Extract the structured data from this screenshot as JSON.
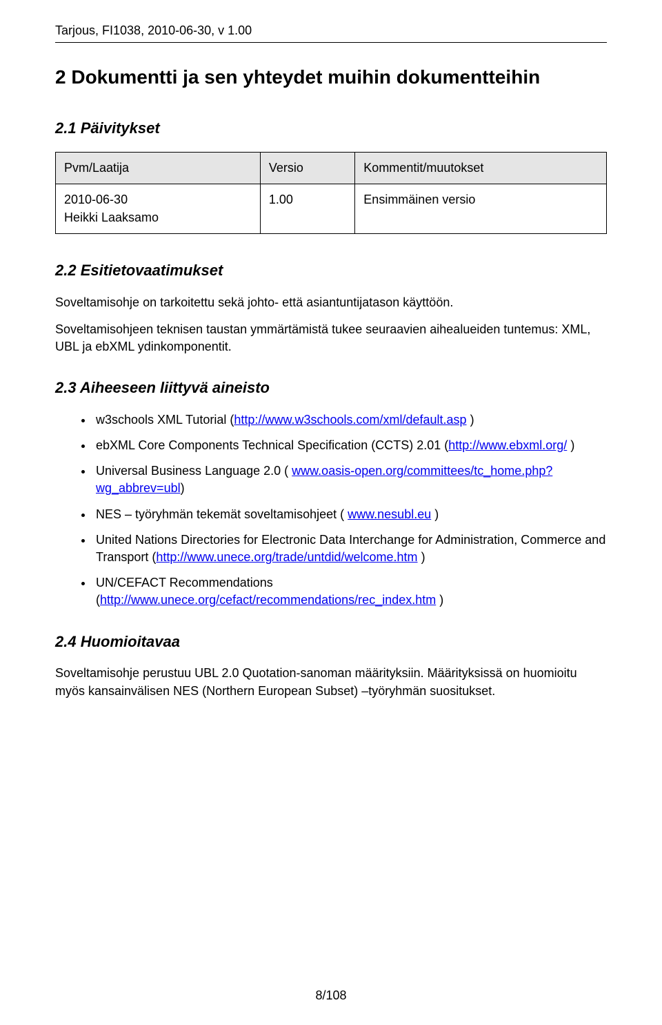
{
  "header": "Tarjous, FI1038, 2010-06-30, v 1.00",
  "chapter": "2   Dokumentti ja sen yhteydet muihin dokumentteihin",
  "sections": {
    "s21": {
      "title": "2.1   Päivitykset",
      "table": {
        "headers": [
          "Pvm/Laatija",
          "Versio",
          "Kommentit/muutokset"
        ],
        "rows": [
          {
            "pvm": "2010-06-30",
            "author": "Heikki Laaksamo",
            "versio": "1.00",
            "kommentit": "Ensimmäinen versio"
          }
        ]
      }
    },
    "s22": {
      "title": "2.2   Esitietovaatimukset",
      "para1": "Soveltamisohje on tarkoitettu sekä johto- että asiantuntijatason käyttöön.",
      "para2": "Soveltamisohjeen teknisen taustan ymmärtämistä tukee seuraavien aihealueiden tuntemus: XML, UBL ja ebXML ydinkomponentit."
    },
    "s23": {
      "title": "2.3   Aiheeseen liittyvä aineisto",
      "items": [
        {
          "pre": "w3schools XML Tutorial (",
          "link": "http://www.w3schools.com/xml/default.asp",
          "post": " )"
        },
        {
          "pre": "ebXML Core Components Technical Specification (CCTS) 2.01 (",
          "link": "http://www.ebxml.org/",
          "post": " )"
        },
        {
          "pre": "Universal Business Language 2.0 ( ",
          "link": "www.oasis-open.org/committees/tc_home.php?wg_abbrev=ubl",
          "post": ")"
        },
        {
          "pre": "NES – työryhmän tekemät soveltamisohjeet ( ",
          "link": "www.nesubl.eu",
          "post": " )"
        },
        {
          "pre": "United Nations Directories for Electronic Data Interchange for Administration, Commerce and Transport (",
          "link": "http://www.unece.org/trade/untdid/welcome.htm",
          "post": " )"
        },
        {
          "pre": "UN/CEFACT Recommendations (",
          "link": "http://www.unece.org/cefact/recommendations/rec_index.htm",
          "post": " )"
        }
      ]
    },
    "s24": {
      "title": "2.4   Huomioitavaa",
      "para": "Soveltamisohje perustuu UBL 2.0 Quotation-sanoman määrityksiin. Määrityksissä on huomioitu myös kansainvälisen NES (Northern European Subset) –työryhmän suositukset."
    }
  },
  "footer": "8/108"
}
